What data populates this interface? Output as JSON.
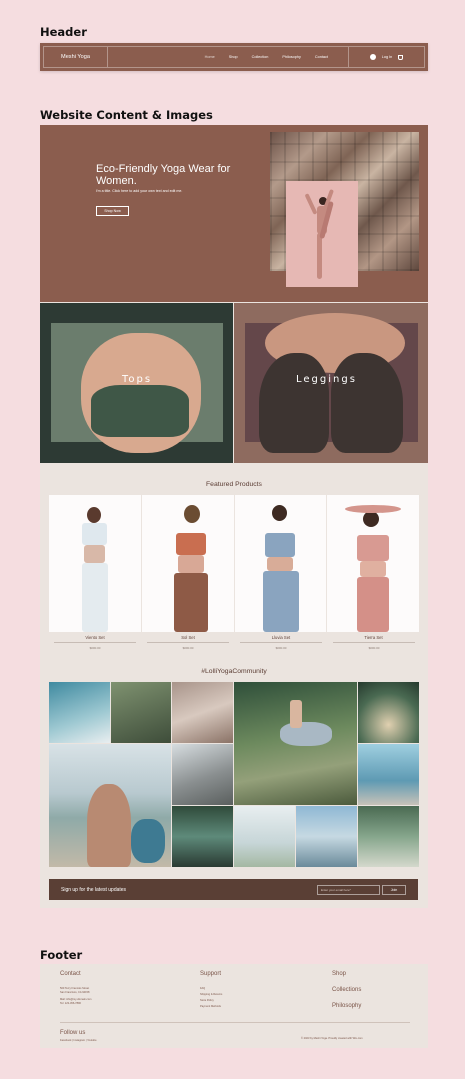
{
  "labels": {
    "header": "Header",
    "content": "Website Content & Images",
    "footer": "Footer"
  },
  "header": {
    "logo": "Meshi Yoga",
    "nav": [
      "Home",
      "Shop",
      "Collection",
      "Philosophy",
      "Contact"
    ],
    "login": "Log In"
  },
  "hero": {
    "title": "Eco-Friendly Yoga Wear for Women.",
    "subtitle": "I'm a title. Click here to add your own text and edit me.",
    "button": "Shop Now"
  },
  "categories": [
    "Tops",
    "Leggings"
  ],
  "featured": {
    "title": "Featured Products",
    "products": [
      {
        "name": "Viento Set",
        "price": "$000.00"
      },
      {
        "name": "Sol Set",
        "price": "$000.00"
      },
      {
        "name": "Lluvia Set",
        "price": "$000.00"
      },
      {
        "name": "Tierra Set",
        "price": "$000.00"
      }
    ]
  },
  "community": {
    "title": "#LolliYogaCommunity"
  },
  "signup": {
    "text": "Sign up for the latest updates",
    "placeholder": "Enter your email here*",
    "button": "Join"
  },
  "footer": {
    "contact_title": "Contact",
    "address_1": "500 Terry Francois Street",
    "address_2": "San Francisco, CA 94158",
    "mail": "Mail: info@my-domain.com",
    "tel": "Tel: 123-456-7890",
    "support_title": "Support",
    "support_links": [
      "FAQ",
      "Shipping & Returns",
      "Store Policy",
      "Payment Methods"
    ],
    "shop_links": [
      "Shop",
      "Collections",
      "Philosophy"
    ],
    "follow_title": "Follow us",
    "social": "Facebook  |  Instagram  |  Youtube",
    "copyright": "© 2023 by Meshi Yoga. Proudly created with Wix.com"
  }
}
